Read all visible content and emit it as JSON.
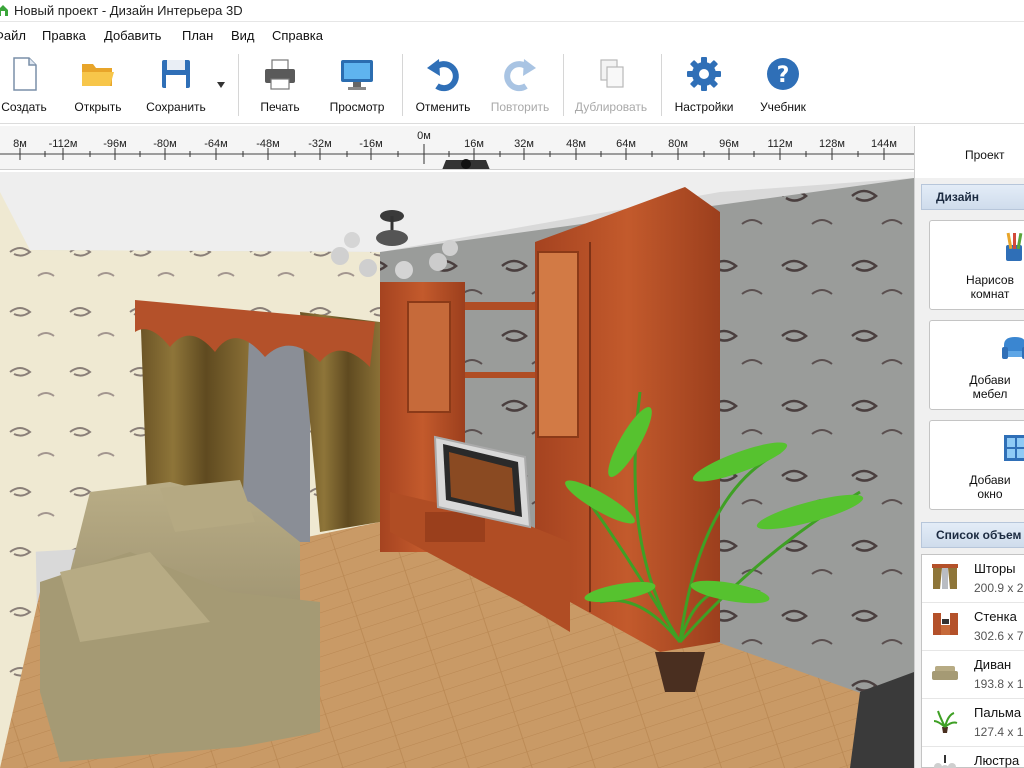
{
  "window": {
    "title": "Новый проект - Дизайн Интерьера 3D"
  },
  "menu": {
    "items": [
      "Файл",
      "Правка",
      "Добавить",
      "План",
      "Вид",
      "Справка"
    ]
  },
  "toolbar": {
    "create": "Создать",
    "open": "Открыть",
    "save": "Сохранить",
    "print": "Печать",
    "preview": "Просмотр",
    "undo": "Отменить",
    "redo": "Повторить",
    "duplicate": "Дублировать",
    "settings": "Настройки",
    "tutorial": "Учебник"
  },
  "ruler": {
    "ticks": [
      "8м",
      "-112м",
      "-96м",
      "-80м",
      "-64м",
      "-48м",
      "-32м",
      "-16м",
      "0м",
      "16м",
      "32м",
      "48м",
      "64м",
      "80м",
      "96м",
      "112м",
      "128м",
      "144м"
    ]
  },
  "right_panel": {
    "tab": "Проект",
    "design_header": "Дизайн",
    "design_buttons": [
      {
        "line1": "Нарисов",
        "line2": "комнат"
      },
      {
        "line1": "Добави",
        "line2": "мебел"
      },
      {
        "line1": "Добави",
        "line2": "окно"
      }
    ],
    "objects_header": "Список объем",
    "objects": [
      {
        "name": "Шторы",
        "size": "200.9 х 2"
      },
      {
        "name": "Стенка",
        "size": "302.6 х 7"
      },
      {
        "name": "Диван",
        "size": "193.8 х 1"
      },
      {
        "name": "Пальма",
        "size": "127.4 х 1"
      },
      {
        "name": "Люстра",
        "size": ""
      }
    ]
  },
  "colors": {
    "accent": "#2f6fb7",
    "furniture": "#b4512a",
    "floor": "#c99a66"
  }
}
